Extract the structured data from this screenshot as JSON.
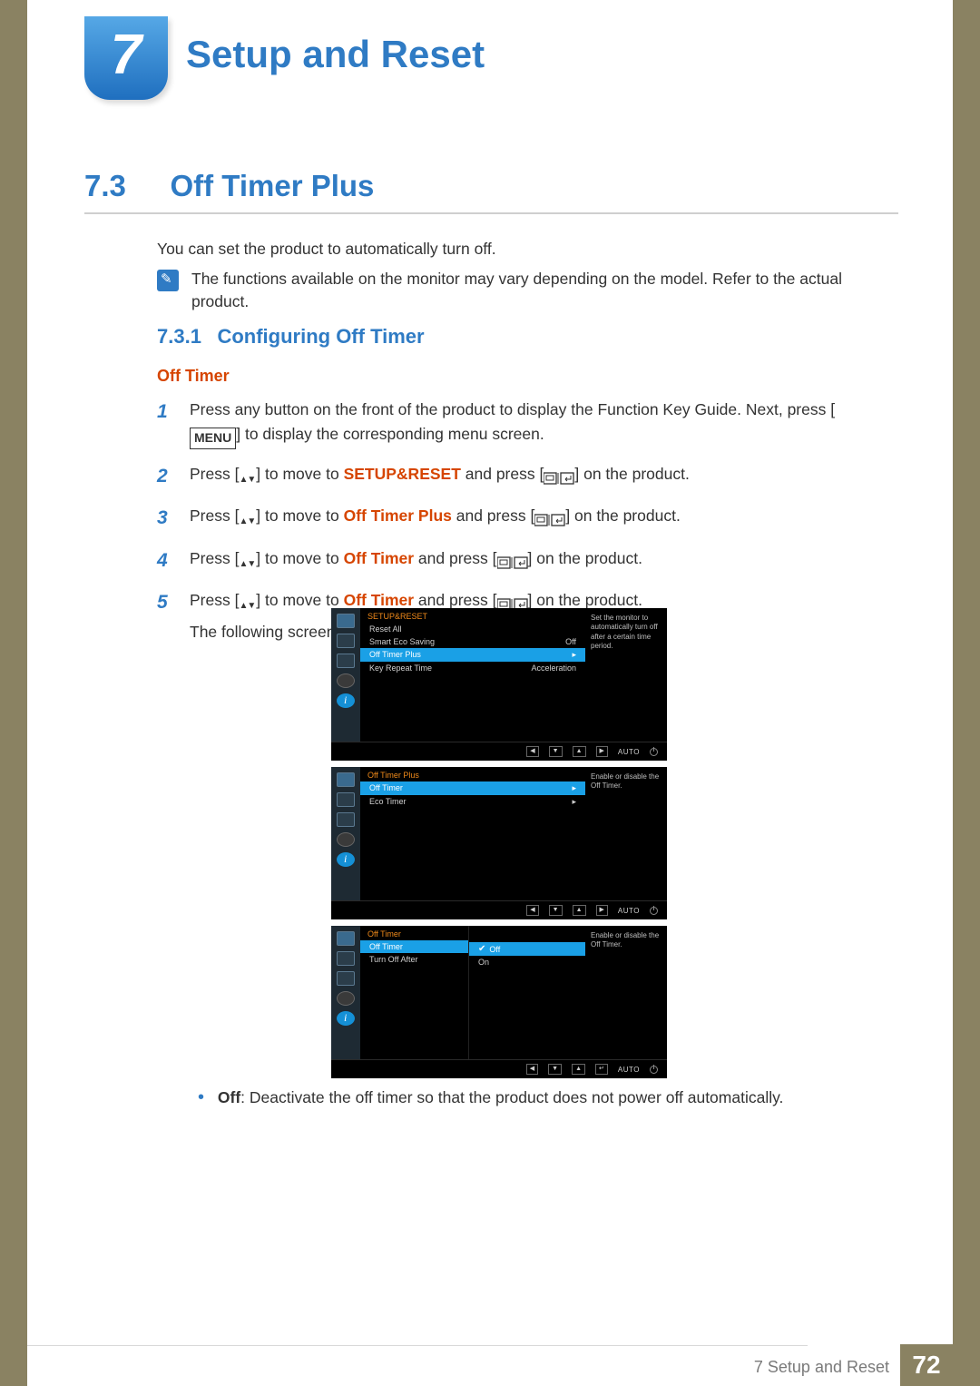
{
  "chapter": {
    "number": "7",
    "title": "Setup and Reset"
  },
  "section": {
    "number": "7.3",
    "title": "Off Timer Plus"
  },
  "intro": "You can set the product to automatically turn off.",
  "note": "The functions available on the monitor may vary depending on the model. Refer to the actual product.",
  "subsection": {
    "number": "7.3.1",
    "title": "Configuring Off Timer"
  },
  "mini_title": "Off Timer",
  "steps": {
    "s1_a": "Press any button on the front of the product to display the Function Key Guide. Next, press [",
    "s1_menu": "MENU",
    "s1_b": "] to display the corresponding menu screen.",
    "s2_a": "Press [",
    "s2_b": "] to move to ",
    "s2_hl": "SETUP&RESET",
    "s2_c": " and press [",
    "s2_d": "] on the product.",
    "s3_a": "Press [",
    "s3_b": "] to move to ",
    "s3_hl": "Off Timer Plus",
    "s3_c": " and press [",
    "s3_d": "] on the product.",
    "s4_a": "Press [",
    "s4_b": "] to move to ",
    "s4_hl": "Off Timer",
    "s4_c": " and press [",
    "s4_d": "] on the product.",
    "s5_a": "Press [",
    "s5_b": "] to move to ",
    "s5_hl": "Off Timer",
    "s5_c": " and press [",
    "s5_d": "] on the product.",
    "following": "The following screen will appear."
  },
  "osd1": {
    "title": "SETUP&RESET",
    "rows": [
      {
        "label": "Reset All",
        "value": ""
      },
      {
        "label": "Smart Eco Saving",
        "value": "Off"
      },
      {
        "label": "Off Timer Plus",
        "value": "▸",
        "sel": true
      },
      {
        "label": "Key Repeat Time",
        "value": "Acceleration"
      }
    ],
    "help": "Set the monitor to automatically turn off after a certain time period.",
    "auto": "AUTO"
  },
  "osd2": {
    "title": "Off Timer Plus",
    "rows": [
      {
        "label": "Off Timer",
        "value": "▸",
        "sel": true
      },
      {
        "label": "Eco Timer",
        "value": "▸"
      }
    ],
    "help": "Enable or disable the Off Timer.",
    "auto": "AUTO"
  },
  "osd3": {
    "title": "Off Timer",
    "left": [
      {
        "label": "Off Timer",
        "sel": true
      },
      {
        "label": "Turn Off After"
      }
    ],
    "right": [
      {
        "label": "Off",
        "sel": true,
        "check": true
      },
      {
        "label": "On"
      }
    ],
    "help": "Enable or disable the Off Timer.",
    "auto": "AUTO"
  },
  "bullet": {
    "label": "Off",
    "text": ": Deactivate the off timer so that the product does not power off automatically."
  },
  "footer": {
    "text": "7 Setup and Reset",
    "page": "72"
  }
}
